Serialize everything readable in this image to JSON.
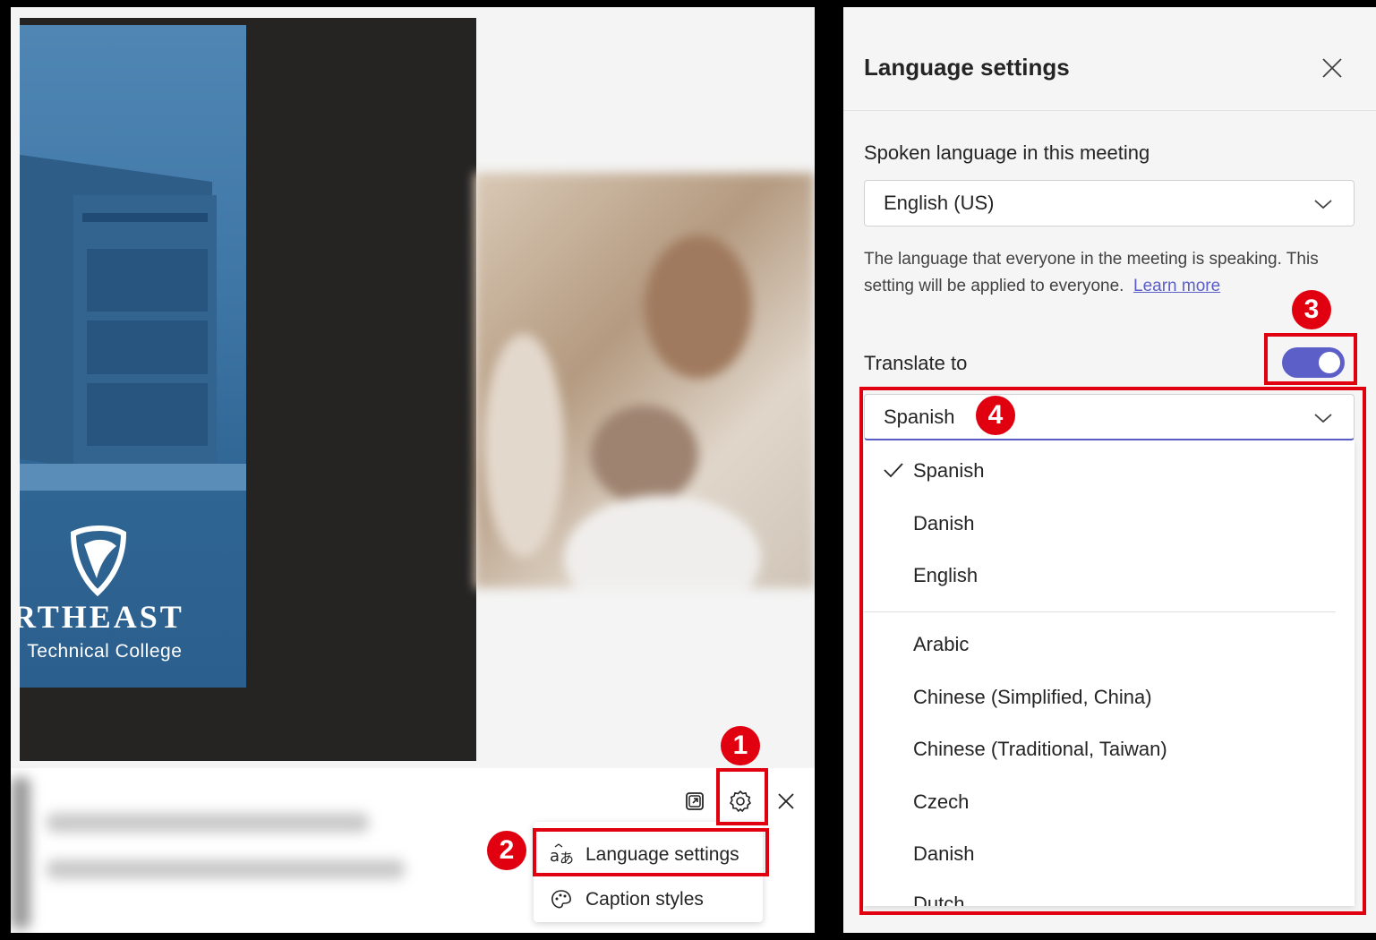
{
  "slide": {
    "title": "RTHEAST",
    "subtitle": "I Technical College",
    "icon": "shield-logo"
  },
  "caption_toolbar": {
    "popout_icon": "popout-icon",
    "settings_icon": "gear-icon",
    "close_icon": "close-icon"
  },
  "caption_menu": {
    "items": [
      {
        "label": "Language settings",
        "icon": "translate-icon"
      },
      {
        "label": "Caption styles",
        "icon": "palette-icon"
      }
    ]
  },
  "language_panel": {
    "title": "Language settings",
    "close_icon": "close-icon",
    "spoken_label": "Spoken language in this meeting",
    "spoken_value": "English (US)",
    "spoken_description": "The language that everyone in the meeting is speaking. This setting will be applied to everyone.",
    "learn_more": "Learn more",
    "translate_label": "Translate to",
    "translate_toggle_on": true,
    "translate_value": "Spanish",
    "options_pinned": [
      "Spanish",
      "Danish",
      "English"
    ],
    "options_all": [
      "Arabic",
      "Chinese (Simplified, China)",
      "Chinese (Traditional, Taiwan)",
      "Czech",
      "Danish",
      "Dutch"
    ],
    "selected_option": "Spanish"
  },
  "annotations": {
    "steps": [
      "1",
      "2",
      "3",
      "4"
    ],
    "color": "#e0000f"
  },
  "colors": {
    "accent": "#5b5fc7",
    "slide_blue": "#3e76a6"
  }
}
